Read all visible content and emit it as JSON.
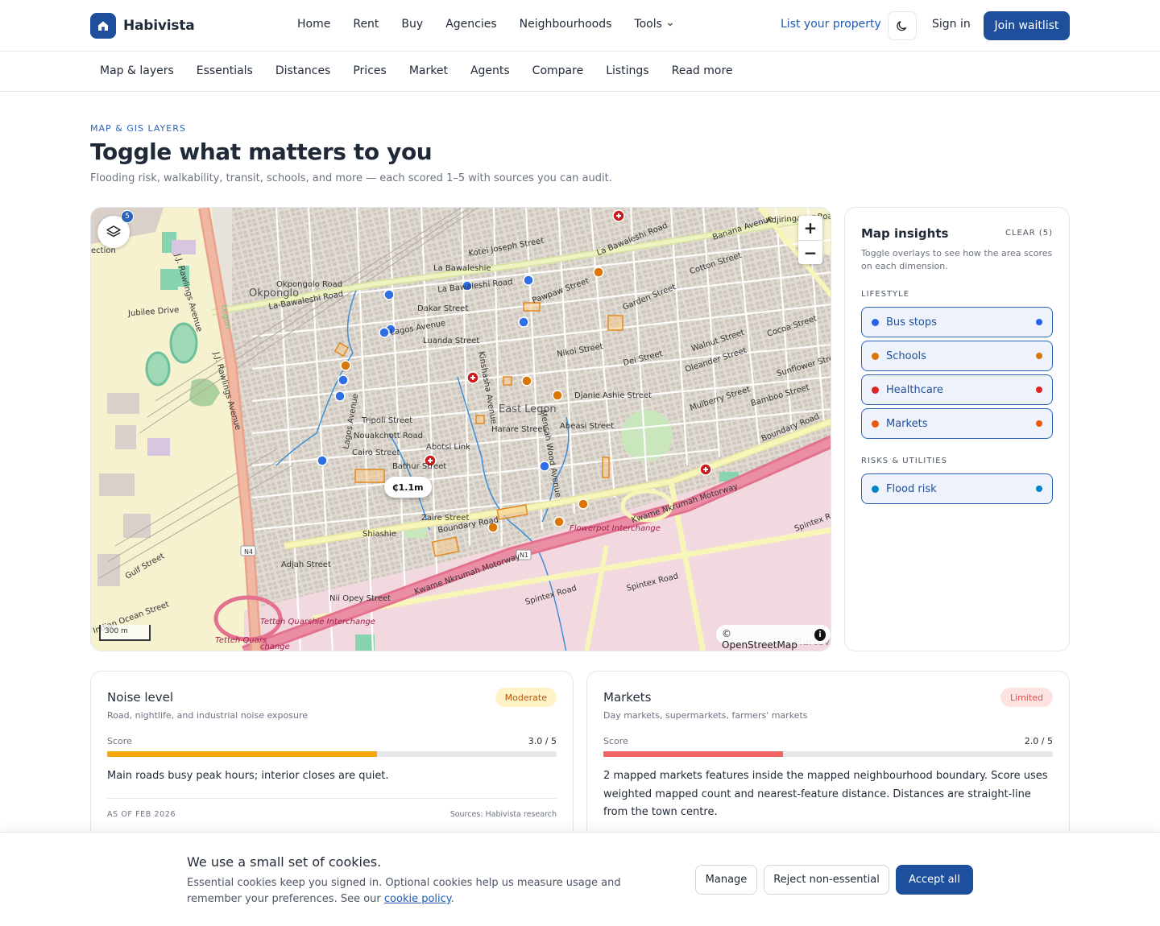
{
  "brand": {
    "name": "Habivista"
  },
  "nav": {
    "items": [
      "Home",
      "Rent",
      "Buy",
      "Agencies",
      "Neighbourhoods"
    ],
    "tools_label": "Tools",
    "list_property": "List your property",
    "sign_in": "Sign in",
    "join_waitlist": "Join waitlist"
  },
  "subnav": [
    "Map & layers",
    "Essentials",
    "Distances",
    "Prices",
    "Market",
    "Agents",
    "Compare",
    "Listings",
    "Read more"
  ],
  "hero": {
    "eyebrow": "MAP & GIS LAYERS",
    "title": "Toggle what matters to you",
    "subtitle": "Flooding risk, walkability, transit, schools, and more — each scored 1–5 with sources you can audit."
  },
  "map": {
    "layers_count": "5",
    "price_pin": "₵1.1m",
    "scale": "300 m",
    "attribution": "© OpenStreetMap",
    "labels": {
      "east_legon": "East Legon",
      "okponglo": "Okponglo",
      "la_bawaleshie": "La Bawaleshie",
      "shiashie": "Shiashie",
      "flowerpot": "Flowerpot Interchange",
      "tetteh": "Tetteh Quarshie Interchange",
      "tetteh2": "Tetteh Quars",
      "tetteh3": "change",
      "kwame1": "Kwame Nkrumah Motorway",
      "kwame2": "Kwame Nkrumah Motorway",
      "boundary": "Boundary Road",
      "boundary2": "Boundary Road",
      "spintex": "Spintex Road",
      "spintex2": "Spintex Road",
      "spintex3": "Spintex Ro",
      "rawlings": "J.J. Rawlings Avenue",
      "rawlings2": "J.J. Rawlings Avenue",
      "lagos": "Lagos Avenue",
      "lagos2": "Lagos Avenue",
      "jubilee": "Jubilee Drive",
      "labawaleshi_road": "La-Bawaleshi Road",
      "labawaleshi_road2": "La Bawaleshi Road",
      "labawaleshi_road3": "La Bawaleshi Road",
      "dakar": "Dakar Street",
      "luanda": "Luanda Street",
      "okpongolo_road": "Okpongolo Road",
      "n4": "N4",
      "n1": "N1",
      "gulf": "Gulf Street",
      "adjah": "Adjah Street",
      "nii_opey": "Nii Opey Street",
      "indian_ocean": "Indian Ocean Street",
      "adjiringanor": "Adjiringanor Road",
      "abotsi": "Abotsi Link",
      "bathur": "Bathur Street",
      "cairo": "Cairo Street",
      "tripoli": "Tripoli Street",
      "nouakchott": "Nouakchott Road",
      "harare": "Harare Street",
      "abeasi": "Abeasi Street",
      "zaire": "Zaire Street",
      "djanie": "Djanie Ashie Street",
      "mensah": "Mensah Wood Avenue",
      "kinshasha": "Kinshasha Avenue",
      "pawpaw": "Pawpaw Street",
      "garden": "Garden Street",
      "walnut": "Walnut Street",
      "oleander": "Oleander Street",
      "cocoa": "Cocoa Street",
      "banana": "Banana Avenue",
      "cotton": "Cotton Street",
      "mulberry": "Mulberry Street",
      "sunflower": "Sunflower Street",
      "bamboo": "Bamboo Street",
      "dei": "Dei Street",
      "nikoi": "Nikoi Street",
      "kotei": "Kotei Joseph Street",
      "ghana_rd": "Gulf Street",
      "legon": "Legon",
      "section": "ection",
      "mortev": "Martev"
    }
  },
  "insights": {
    "title": "Map insights",
    "clear": "CLEAR (5)",
    "subtitle": "Toggle overlays to see how the area scores on each dimension.",
    "lifestyle_label": "LIFESTYLE",
    "risks_label": "RISKS & UTILITIES",
    "lifestyle": [
      {
        "label": "Bus stops",
        "color": "#2563eb"
      },
      {
        "label": "Schools",
        "color": "#d97706"
      },
      {
        "label": "Healthcare",
        "color": "#dc2626"
      },
      {
        "label": "Markets",
        "color": "#ea580c"
      }
    ],
    "risks": [
      {
        "label": "Flood risk",
        "color": "#0284c7"
      }
    ]
  },
  "cards": [
    {
      "title": "Noise level",
      "subtitle": "Road, nightlife, and industrial noise exposure",
      "badge": "Moderate",
      "badge_bg": "#fef3c7",
      "badge_fg": "#b45309",
      "score_label": "Score",
      "score_text": "3.0 / 5",
      "score_fraction": 0.6,
      "bar_color": "#f5a70b",
      "body": "Main roads busy peak hours; interior closes are quiet.",
      "as_of": "AS OF FEB 2026",
      "sources": "Sources: Habivista research"
    },
    {
      "title": "Markets",
      "subtitle": "Day markets, supermarkets, farmers' markets",
      "badge": "Limited",
      "badge_bg": "#fde2e2",
      "badge_fg": "#e05252",
      "score_label": "Score",
      "score_text": "2.0 / 5",
      "score_fraction": 0.4,
      "bar_color": "#f26464",
      "body": "2 mapped markets features inside the mapped neighbourhood boundary. Score uses weighted mapped count and nearest-feature distance. Distances are straight-line from the town centre."
    }
  ],
  "cookie": {
    "title": "We use a small set of cookies.",
    "body": "Essential cookies keep you signed in. Optional cookies help us measure usage and remember your preferences. See our ",
    "link": "cookie policy",
    "tail": ".",
    "manage": "Manage",
    "reject": "Reject non-essential",
    "accept": "Accept all"
  }
}
